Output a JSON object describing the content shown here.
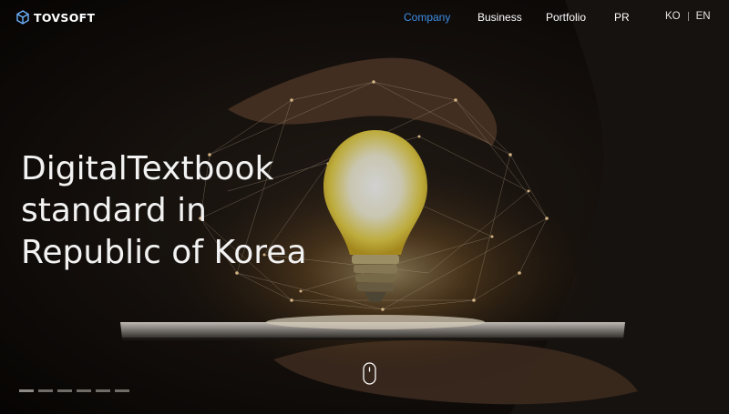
{
  "brand": {
    "name": "TOVSOFT",
    "icon": "tovsoft-cube-logo"
  },
  "nav": {
    "items": [
      {
        "label": "Company",
        "active": true
      },
      {
        "label": "Business",
        "active": false
      },
      {
        "label": "Portfolio",
        "active": false
      },
      {
        "label": "PR",
        "active": false
      }
    ],
    "active_color": "#3d8ee8"
  },
  "language": {
    "ko": "KO",
    "en": "EN",
    "selected": "EN"
  },
  "hero": {
    "line1": "DigitalTextbook",
    "line2": "standard in",
    "line3": "Republic of Korea",
    "image": "hands holding tablet with glowing light bulb and network lines"
  },
  "slider": {
    "count": 6,
    "current": 1
  },
  "scroll_indicator": {
    "icon": "mouse-scroll-icon"
  }
}
